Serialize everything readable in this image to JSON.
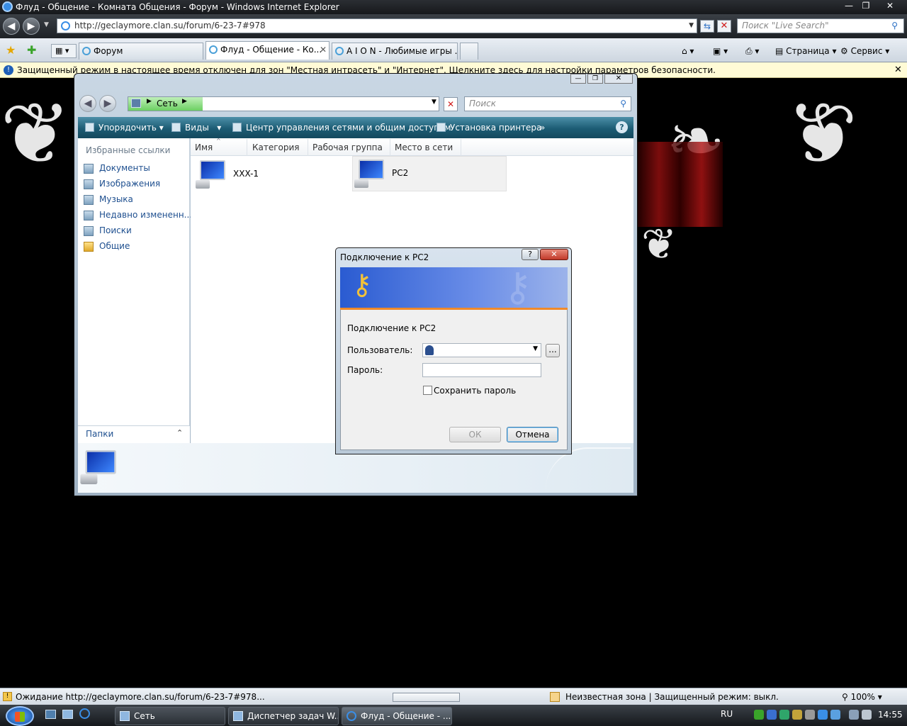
{
  "ie": {
    "title": "Флуд - Общение - Комната Общения - Форум - Windows Internet Explorer",
    "url": "http://geclaymore.clan.su/forum/6-23-7#978",
    "search_placeholder": "Поиск \"Live Search\"",
    "tabs": [
      {
        "label": "Форум"
      },
      {
        "label": "Флуд - Общение - Ко..."
      },
      {
        "label": "A I O N - Любимые игры ..."
      }
    ],
    "commands": {
      "page": "Страница",
      "tools": "Сервис"
    },
    "infobar": "Защищенный режим в настоящее время отключен для зон \"Местная интрасеть\" и \"Интернет\". Щелкните здесь для настройки параметров безопасности.",
    "status": {
      "text": "Ожидание http://geclaymore.clan.su/forum/6-23-7#978...",
      "zone": "Неизвестная зона | Защищенный режим: выкл.",
      "zoom": "100%"
    }
  },
  "explorer": {
    "breadcrumb": "Сеть",
    "search_placeholder": "Поиск",
    "toolbar": {
      "organize": "Упорядочить",
      "views": "Виды",
      "network_center": "Центр управления сетями и общим доступом",
      "printer": "Установка принтера",
      "more": "»",
      "help": "?"
    },
    "favorites_title": "Избранные ссылки",
    "favorites": [
      {
        "label": "Документы"
      },
      {
        "label": "Изображения"
      },
      {
        "label": "Музыка"
      },
      {
        "label": "Недавно измененн..."
      },
      {
        "label": "Поиски"
      },
      {
        "label": "Общие"
      }
    ],
    "folders_label": "Папки",
    "columns": [
      "Имя",
      "Категория",
      "Рабочая группа",
      "Место в сети"
    ],
    "computers": [
      {
        "name": "XXX-1"
      },
      {
        "name": "PC2"
      }
    ]
  },
  "dialog": {
    "title": "Подключение к PC2",
    "message": "Подключение к PC2",
    "user_label": "Пользователь:",
    "password_label": "Пароль:",
    "remember_label": "Сохранить пароль",
    "remember_checked": false,
    "ok_label": "ОК",
    "cancel_label": "Отмена",
    "browse_label": "..."
  },
  "taskbar": {
    "buttons": [
      {
        "label": "Сеть"
      },
      {
        "label": "Диспетчер задач W..."
      },
      {
        "label": "Флуд - Общение - ..."
      }
    ],
    "lang": "RU",
    "clock": "14:55"
  }
}
